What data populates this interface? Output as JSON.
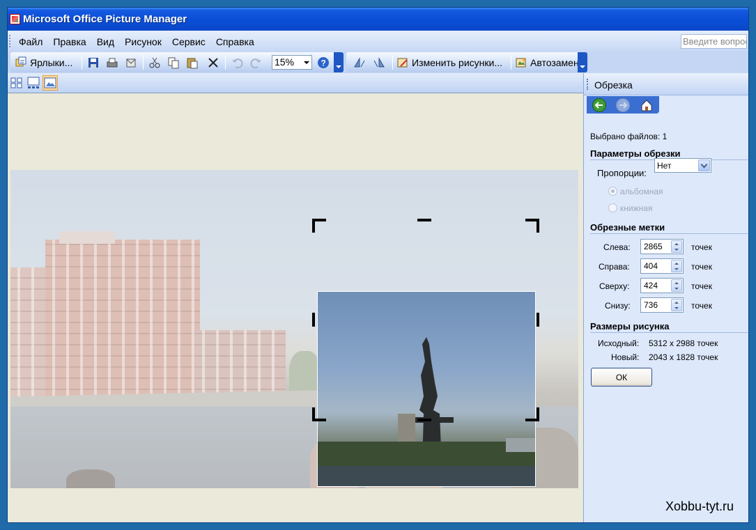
{
  "window": {
    "title": "Microsoft Office Picture Manager"
  },
  "menu": {
    "items": [
      "Файл",
      "Правка",
      "Вид",
      "Рисунок",
      "Сервис",
      "Справка"
    ],
    "help_placeholder": "Введите вопрос"
  },
  "toolbar": {
    "shortcuts_label": "Ярлыки...",
    "zoom_value": "15%",
    "edit_pictures_label": "Изменить рисунки...",
    "autocorrect_label": "Автозамена"
  },
  "taskpane": {
    "title": "Обрезка",
    "files_selected": "Выбрано файлов: 1",
    "crop_params_header": "Параметры обрезки",
    "proportions_label": "Пропорции:",
    "proportions_value": "Нет",
    "landscape_label": "альбомная",
    "portrait_label": "книжная",
    "crop_marks_header": "Обрезные метки",
    "fields": [
      {
        "label": "Слева:",
        "value": "2865",
        "unit": "точек"
      },
      {
        "label": "Справа:",
        "value": "404",
        "unit": "точек"
      },
      {
        "label": "Сверху:",
        "value": "424",
        "unit": "точек"
      },
      {
        "label": "Снизу:",
        "value": "736",
        "unit": "точек"
      }
    ],
    "size_header": "Размеры рисунка",
    "original_label": "Исходный:",
    "original_value": "5312 x 2988 точек",
    "new_label": "Новый:",
    "new_value": "2043 x 1828 точек",
    "ok_label": "ОК"
  },
  "watermark": "Xobbu-tyt.ru"
}
